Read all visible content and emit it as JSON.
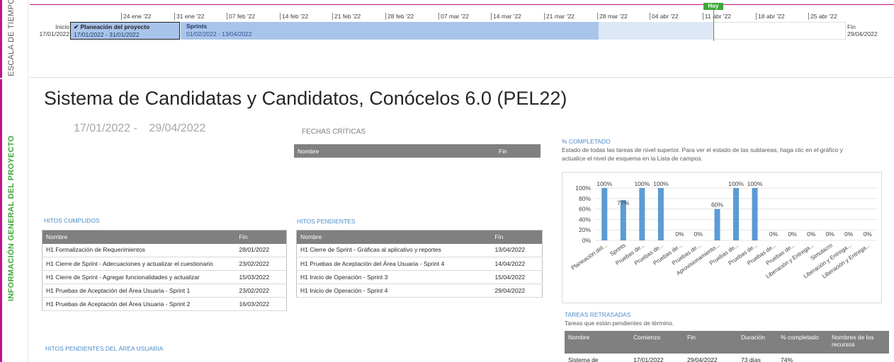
{
  "side_labels": {
    "timescale": "ESCALA DE TIEMPO",
    "project_info": "INFORMACIÓN GENERAL DEL PROYECTO"
  },
  "timeline": {
    "ticks": [
      "24 ene '22",
      "31 ene '22",
      "07 feb '22",
      "14 feb '22",
      "21 feb '22",
      "28 feb '22",
      "07 mar '22",
      "14 mar '22",
      "21 mar '22",
      "28 mar '22",
      "04 abr '22",
      "11 abr '22",
      "18 abr '22",
      "25 abr '22"
    ],
    "start_label": "Inicio",
    "start_date": "17/01/2022",
    "end_label": "Fin",
    "end_date": "29/04/2022",
    "today_label": "Hoy",
    "plan_task": {
      "name": "✔ Planeación del proyecto",
      "range": "17/01/2022 - 31/01/2022"
    },
    "sprints_task": {
      "name": "Sprints",
      "range": "01/02/2022 - 13/04/2022"
    }
  },
  "title": "Sistema de Candidatas y Candidatos, Conócelos 6.0 (PEL22)",
  "dates": {
    "start": "17/01/2022",
    "sep": "-",
    "end": "29/04/2022"
  },
  "critical": {
    "title": "FECHAS CRÍTICAS",
    "col_name": "Nombre",
    "col_end": "Fin"
  },
  "milestones_done": {
    "title": "HITOS CUMPLIDOS",
    "col_name": "Nombre",
    "col_end": "Fin",
    "rows": [
      {
        "name": "H1 Formalización de Requerimientos",
        "end": "28/01/2022"
      },
      {
        "name": "H1 Cierre de Sprint - Adecuaciones y actualizar el cuestionario",
        "end": "23/02/2022"
      },
      {
        "name": "H1 Cierre de Sprint - Agregar funcionalidades y actualizar",
        "end": "15/03/2022"
      },
      {
        "name": "H1 Pruebas de Aceptación del Área Usuaria - Sprint 1",
        "end": "23/02/2022"
      },
      {
        "name": "H1 Pruebas de Aceptación del Área Usuaria - Sprint 2",
        "end": "16/03/2022"
      }
    ]
  },
  "milestones_pending": {
    "title": "HITOS PENDIENTES",
    "col_name": "Nombre",
    "col_end": "Fin",
    "rows": [
      {
        "name": "H1 Cierre de Sprint - Gráficas al aplicativo y reportes",
        "end": "13/04/2022"
      },
      {
        "name": "H1 Pruebas de Aceptación del Área Usuaria - Sprint 4",
        "end": "14/04/2022"
      },
      {
        "name": "H1 Inicio de Operación - Sprint 3",
        "end": "15/04/2022"
      },
      {
        "name": "H1 Inicio de Operación - Sprint 4",
        "end": "29/04/2022"
      }
    ]
  },
  "user_area_pending": {
    "title": "HITOS PENDIENTES DEL ÁREA USUARIA"
  },
  "completion": {
    "title": "% COMPLETADO",
    "description": "Estado de todas las tareas de nivel superior. Para ver el estado de las subtareas, haga clic en el gráfico y actualice el nivel de esquema en la Lista de campos."
  },
  "chart_data": {
    "type": "bar",
    "categories": [
      "Planeación del...",
      "Sprints",
      "Pruebas de...",
      "Pruebas de...",
      "Pruebas de...",
      "Pruebas de...",
      "Aprovisionamiento...",
      "Pruebas de...",
      "Pruebas de...",
      "Pruebas de...",
      "Pruebas de...",
      "Liberación y Entrega...",
      "Simulacro",
      "Liberación y Entrega...",
      "Liberación y Entrega..."
    ],
    "values": [
      100,
      77,
      100,
      100,
      0,
      0,
      60,
      100,
      100,
      0,
      0,
      0,
      0,
      0,
      0
    ],
    "data_labels": [
      "100%",
      "77%",
      "100%",
      "100%",
      "0%",
      "0%",
      "60%",
      "100%",
      "100%",
      "0%",
      "0%",
      "0%",
      "0%",
      "0%",
      "0%"
    ],
    "y_ticks": [
      "0%",
      "20%",
      "40%",
      "60%",
      "80%",
      "100%"
    ],
    "ylim": [
      0,
      100
    ],
    "grid": true,
    "bar_color": "#5b9bd5"
  },
  "late_tasks": {
    "title": "TAREAS RETRASADAS",
    "subtitle": "Tareas que están pendientes de término.",
    "columns": [
      "Nombre",
      "Comienzo",
      "Fin",
      "Duración",
      "% completado",
      "Nombres de los recursos"
    ],
    "rows": [
      {
        "name": "Sistema de",
        "start": "17/01/2022",
        "end": "29/04/2022",
        "duration": "73 días",
        "pct": "74%",
        "resources": ""
      }
    ]
  },
  "colors": {
    "accent": "#c0148c",
    "green": "#3fa83a",
    "header_gray": "#808080",
    "bar_blue": "#a9c4eb",
    "section_blue": "#4a8bc9"
  }
}
